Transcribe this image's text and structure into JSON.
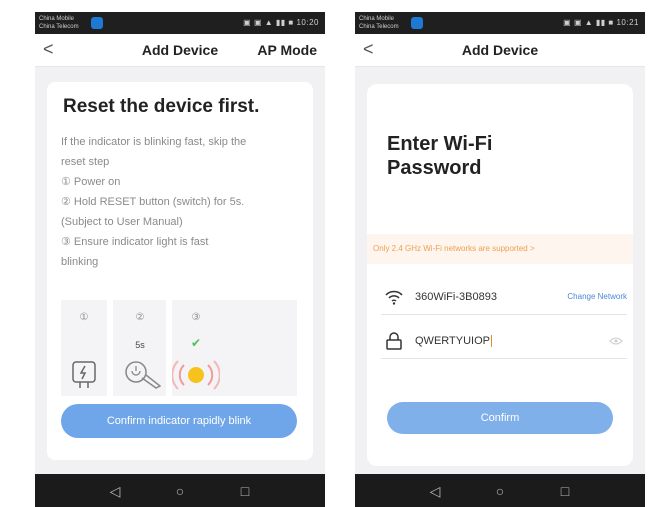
{
  "left_screen": {
    "status": {
      "carrier_line1": "China Mobile",
      "carrier_line2": "China Telecom",
      "time": "10:20"
    },
    "nav": {
      "back": "<",
      "title": "Add Device",
      "right": "AP Mode"
    },
    "card": {
      "title": "Reset the device first.",
      "steps": [
        "If the indicator is blinking fast, skip the",
        "reset step",
        "① Power on",
        "② Hold RESET button (switch) for 5s.",
        "(Subject to User Manual)",
        "③ Ensure indicator light is fast",
        "blinking"
      ],
      "illustration": {
        "step_numbers": [
          "①",
          "②",
          "③"
        ],
        "hold_time": "5s",
        "check": "✔"
      },
      "confirm_button": "Confirm indicator rapidly blink"
    }
  },
  "right_screen": {
    "status": {
      "carrier_line1": "China Mobile",
      "carrier_line2": "China Telecom",
      "time": "10:21"
    },
    "nav": {
      "back": "<",
      "title": "Add Device"
    },
    "card": {
      "title_line1": "Enter Wi-Fi",
      "title_line2": "Password",
      "banner": "Only 2.4 GHz Wi-Fi networks are supported >",
      "ssid": "360WiFi-3B0893",
      "change_network": "Change Network",
      "password_value": "QWERTYUIOP",
      "confirm_button": "Confirm"
    }
  },
  "system_nav": {
    "back": "◁",
    "home": "○",
    "recent": "□"
  },
  "colors": {
    "accent_blue": "#6fa6e9",
    "warning_orange": "#f0a050",
    "success_green": "#4cc05a"
  }
}
